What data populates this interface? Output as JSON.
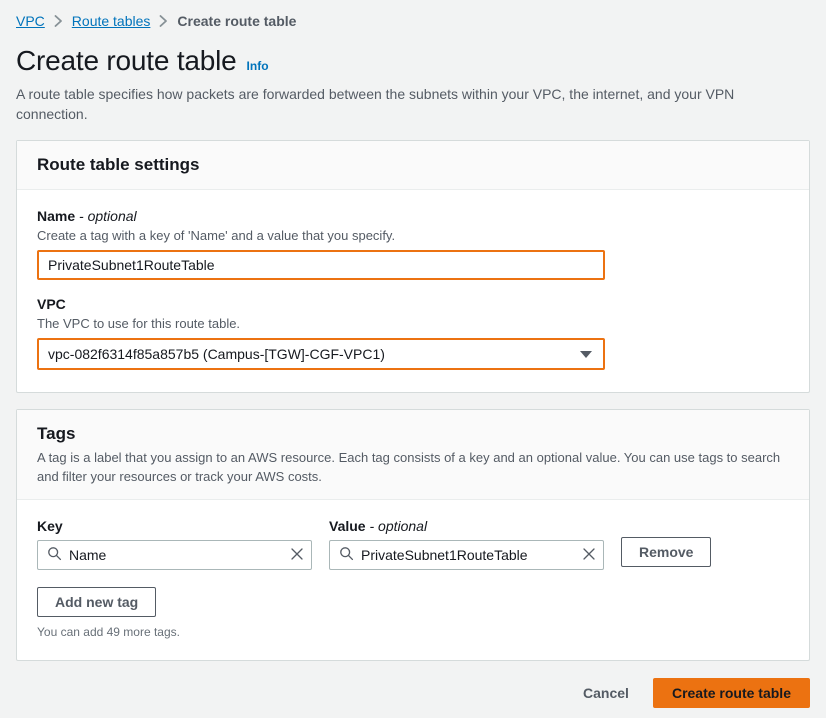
{
  "breadcrumb": {
    "items": [
      {
        "label": "VPC",
        "type": "link"
      },
      {
        "label": "Route tables",
        "type": "link"
      },
      {
        "label": "Create route table",
        "type": "current"
      }
    ],
    "separator_icon": "chevron-right-icon"
  },
  "header": {
    "title": "Create route table",
    "info_label": "Info",
    "description": "A route table specifies how packets are forwarded between the subnets within your VPC, the internet, and your VPN connection."
  },
  "settings_card": {
    "title": "Route table settings",
    "name_field": {
      "label": "Name",
      "optional_suffix": "- optional",
      "description": "Create a tag with a key of 'Name' and a value that you specify.",
      "value": "PrivateSubnet1RouteTable",
      "placeholder": ""
    },
    "vpc_field": {
      "label": "VPC",
      "description": "The VPC to use for this route table.",
      "selected": "vpc-082f6314f85a857b5 (Campus-[TGW]-CGF-VPC1)",
      "caret_icon": "chevron-down-icon"
    }
  },
  "tags_card": {
    "title": "Tags",
    "description": "A tag is a label that you assign to an AWS resource. Each tag consists of a key and an optional value. You can use tags to search and filter your resources or track your AWS costs.",
    "key_column_label": "Key",
    "value_column_label": "Value",
    "value_optional_suffix": "- optional",
    "rows": [
      {
        "key": "Name",
        "value": "PrivateSubnet1RouteTable",
        "remove_label": "Remove",
        "search_icon": "search-icon",
        "clear_icon": "close-icon"
      }
    ],
    "add_tag_label": "Add new tag",
    "hint": "You can add 49 more tags."
  },
  "footer": {
    "cancel_label": "Cancel",
    "submit_label": "Create route table"
  },
  "colors": {
    "accent_orange": "#ec7211",
    "link_blue": "#0073bb",
    "page_background": "#f2f3f3",
    "text_primary": "#16191f",
    "text_secondary": "#545b64",
    "border": "#d5dbdb"
  }
}
